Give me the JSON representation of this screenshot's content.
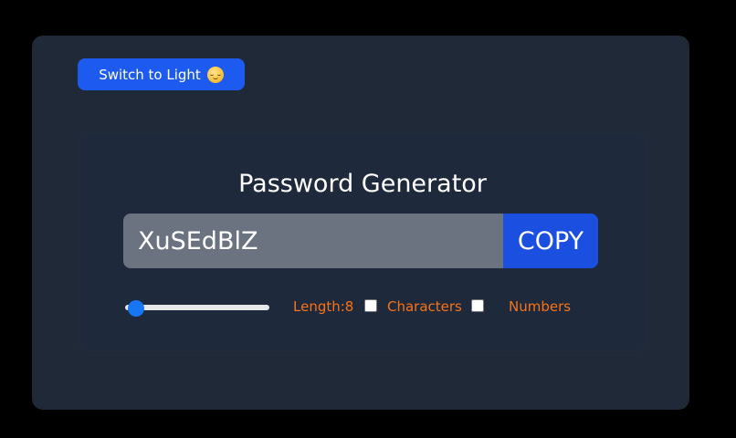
{
  "theme_toggle": {
    "label": "Switch to Light",
    "icon": "smiling-face-emoji-icon"
  },
  "generator": {
    "title": "Password Generator",
    "password_value": "XuSEdBlZ",
    "copy_label": "COPY"
  },
  "controls": {
    "length_label": "Length:8",
    "length_value": 8,
    "length_slider_fraction": 0.02,
    "characters_label": "Characters",
    "characters_checked": false,
    "numbers_label": "Numbers",
    "numbers_checked": false
  },
  "colors": {
    "page_background": "#000000",
    "frame_background": "#1f2937",
    "card_background": "#1e293b",
    "primary_button": "#1d5af0",
    "copy_button": "#1a4fe0",
    "input_background": "#6b7280",
    "label_orange": "#f97316",
    "slider_thumb": "#1676f3"
  }
}
